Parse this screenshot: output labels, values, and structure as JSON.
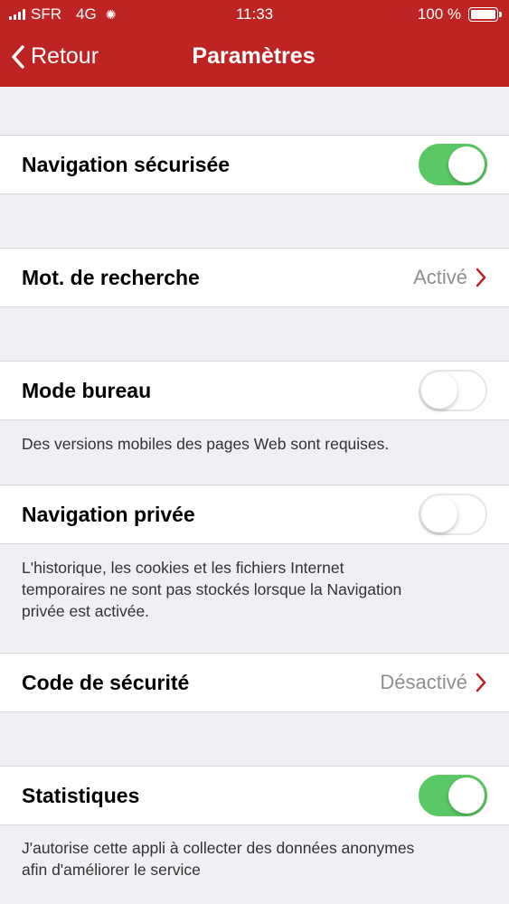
{
  "status_bar": {
    "carrier": "SFR",
    "network": "4G",
    "time": "11:33",
    "battery": "100 %"
  },
  "nav": {
    "back_label": "Retour",
    "title": "Paramètres"
  },
  "settings": {
    "secure_navigation": {
      "label": "Navigation sécurisée",
      "enabled": true
    },
    "search_engine": {
      "label": "Mot. de recherche",
      "value": "Activé"
    },
    "desktop_mode": {
      "label": "Mode bureau",
      "enabled": false,
      "note": "Des versions mobiles des pages Web sont requises."
    },
    "private_navigation": {
      "label": "Navigation privée",
      "enabled": false,
      "note_line1": "L'historique, les cookies et les fichiers Internet",
      "note_line2": "temporaires ne sont pas stockés lorsque la Navigation",
      "note_line3": "privée est activée."
    },
    "security_code": {
      "label": "Code de sécurité",
      "value": "Désactivé"
    },
    "statistics": {
      "label": "Statistiques",
      "enabled": true,
      "note_line1": "J'autorise cette appli à collecter des données anonymes",
      "note_line2": "afin d'améliorer le service"
    }
  },
  "colors": {
    "accent": "#bf2424",
    "toggle_on": "#5ac864"
  }
}
